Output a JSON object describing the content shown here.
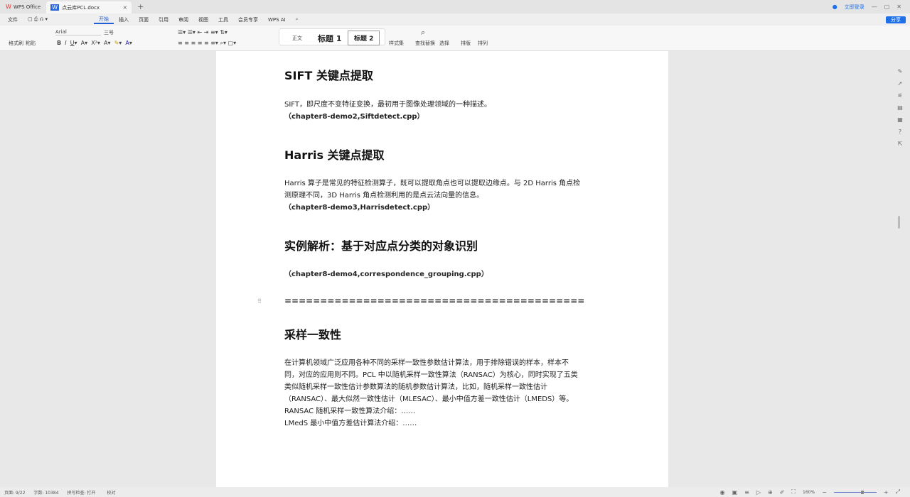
{
  "tabs": {
    "app": "WPS Office",
    "doc": "点云库PCL.docx",
    "new": "+"
  },
  "window": {
    "login": "立即登录",
    "share": "分享"
  },
  "menu": {
    "file": "文件",
    "items": [
      "开始",
      "插入",
      "页面",
      "引用",
      "审阅",
      "视图",
      "工具",
      "会员专享"
    ],
    "ai": "WPS AI"
  },
  "ribbon": {
    "format_painter": "格式刷",
    "paste": "粘贴",
    "font": "Arial",
    "size": "三号",
    "styles": [
      "正文",
      "标题 1",
      "标题 2"
    ],
    "style_set": "样式集",
    "find_replace": "查找替换",
    "select": "选择",
    "layout": "排版",
    "arrange": "排列"
  },
  "doc": {
    "h1": "SIFT 关键点提取",
    "p1": "SIFT，即尺度不变特征变换，最初用于图像处理领域的一种描述。",
    "c1": "（chapter8-demo2,Siftdetect.cpp）",
    "h2": "Harris 关键点提取",
    "p2a": "Harris 算子是常见的特征检测算子，既可以提取角点也可以提取边缘点。与 2D Harris 角点检",
    "p2b": "测原理不同，3D Harris 角点检测利用的是点云法向量的信息。",
    "c2": "（chapter8-demo3,Harrisdetect.cpp）",
    "h3": "实例解析：基于对应点分类的对象识别",
    "c3": "（chapter8-demo4,correspondence_grouping.cpp）",
    "sep": "==========================================",
    "h4": "采样一致性",
    "p4": [
      "在计算机领域广泛应用各种不同的采样一致性参数估计算法，用于排除错误的样本，样本不",
      "同，对应的应用则不同。PCL 中以随机采样一致性算法（RANSAC）为核心，同时实现了五类",
      "类似随机采样一致性估计参数算法的随机参数估计算法，比如，随机采样一致性估计",
      "（RANSAC）、最大似然一致性估计（MLESAC）、最小中值方差一致性估计（LMEDS）等。",
      "RANSAC 随机采样一致性算法介绍：……",
      "LMedS 最小中值方差估计算法介绍：……"
    ]
  },
  "status": {
    "page": "页面: 9/22",
    "words": "字数: 10384",
    "spell": "拼写检查: 打开",
    "proof": "校对",
    "zoom": "160%"
  },
  "colors": {
    "accent": "#1e6fe8"
  }
}
